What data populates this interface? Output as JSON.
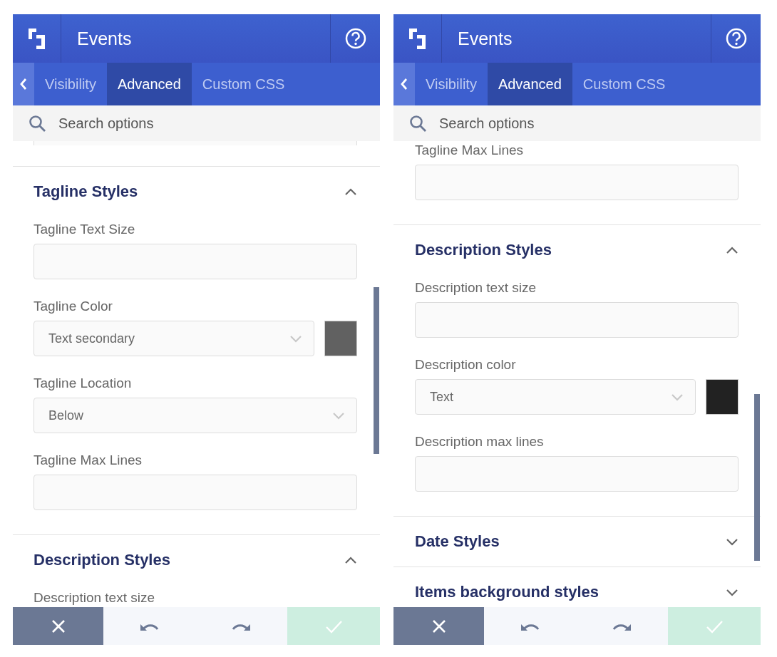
{
  "panels": [
    {
      "header": {
        "title": "Events"
      },
      "tabs": [
        {
          "label": "Visibility",
          "selected": false
        },
        {
          "label": "Advanced",
          "selected": true
        },
        {
          "label": "Custom CSS",
          "selected": false
        }
      ],
      "search": {
        "placeholder": "Search options"
      },
      "sections": [
        {
          "fields": [
            {
              "kind": "text"
            }
          ]
        },
        {
          "title": "Tagline Styles",
          "expanded": true,
          "fields": [
            {
              "kind": "text",
              "label": "Tagline Text Size"
            },
            {
              "kind": "color-select",
              "label": "Tagline Color",
              "value": "Text secondary",
              "color": "#616161"
            },
            {
              "kind": "select",
              "label": "Tagline Location",
              "value": "Below"
            },
            {
              "kind": "text",
              "label": "Tagline Max Lines"
            }
          ]
        },
        {
          "title": "Description Styles",
          "expanded": true,
          "fields": [
            {
              "label": "Description text size"
            }
          ]
        }
      ]
    },
    {
      "header": {
        "title": "Events"
      },
      "tabs": [
        {
          "label": "Visibility",
          "selected": false
        },
        {
          "label": "Advanced",
          "selected": true
        },
        {
          "label": "Custom CSS",
          "selected": false
        }
      ],
      "search": {
        "placeholder": "Search options"
      },
      "sections": [
        {
          "fields": [
            {
              "kind": "text",
              "label": "Tagline Max Lines"
            }
          ]
        },
        {
          "title": "Description Styles",
          "expanded": true,
          "fields": [
            {
              "kind": "text",
              "label": "Description text size"
            },
            {
              "kind": "color-select",
              "label": "Description color",
              "value": "Text",
              "color": "#222222"
            },
            {
              "kind": "text",
              "label": "Description max lines"
            }
          ]
        },
        {
          "title": "Date Styles",
          "expanded": false
        },
        {
          "title": "Items background styles",
          "expanded": false
        }
      ]
    }
  ]
}
